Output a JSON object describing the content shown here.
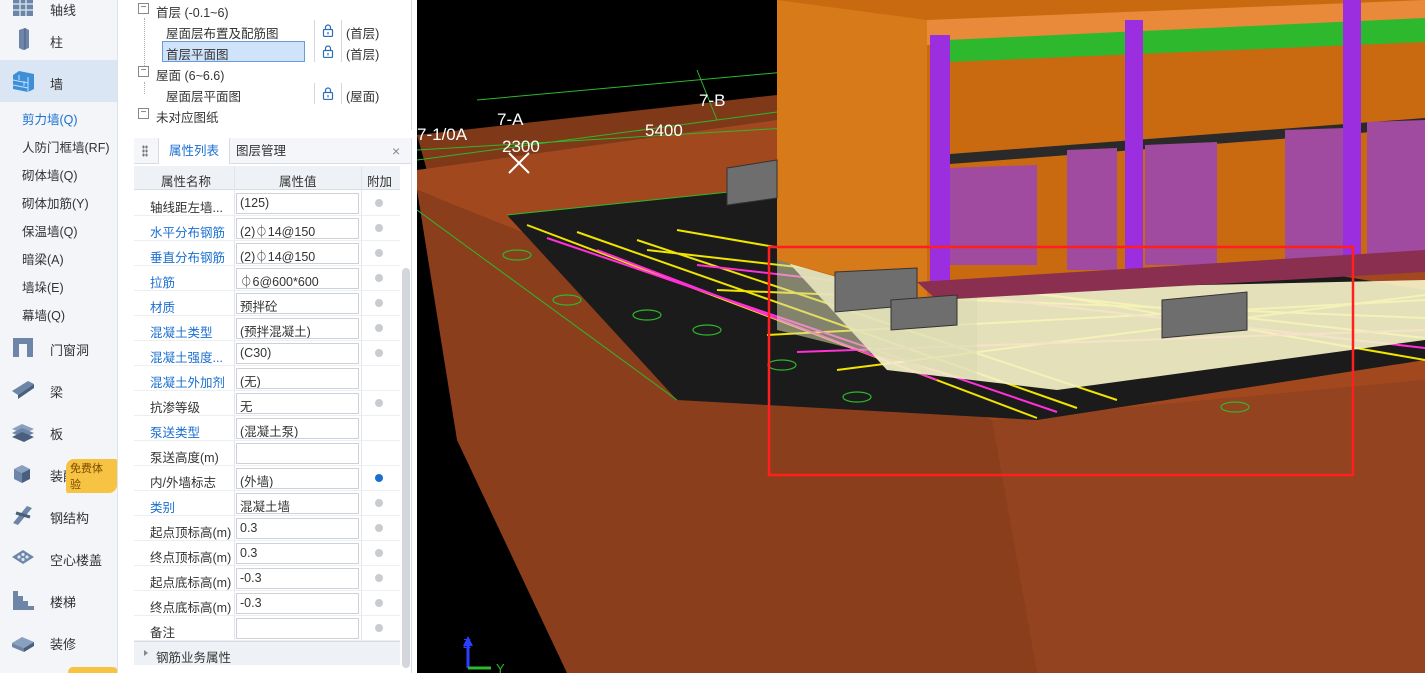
{
  "sidebar": {
    "categories": [
      {
        "label": "轴线",
        "icon": "grid-icon"
      },
      {
        "label": "柱",
        "icon": "column-icon"
      },
      {
        "label": "墙",
        "icon": "wall-icon"
      },
      {
        "label": "门窗洞",
        "icon": "door-window-icon"
      },
      {
        "label": "梁",
        "icon": "beam-icon"
      },
      {
        "label": "板",
        "icon": "slab-icon"
      },
      {
        "label": "装配式",
        "icon": "prefab-icon"
      },
      {
        "label": "钢结构",
        "icon": "steel-icon"
      },
      {
        "label": "空心楼盖",
        "icon": "hollow-slab-icon"
      },
      {
        "label": "楼梯",
        "icon": "stairs-icon"
      },
      {
        "label": "装修",
        "icon": "decoration-icon"
      }
    ],
    "wall_subitems": [
      "剪力墙(Q)",
      "人防门框墙(RF)",
      "砌体墙(Q)",
      "砌体加筋(Y)",
      "保温墙(Q)",
      "暗梁(A)",
      "墙垛(E)",
      "幕墙(Q)"
    ],
    "badge": "免费体验"
  },
  "tree": {
    "rows": [
      {
        "name": "首层 (-0.1~6)",
        "toggle": "−",
        "type": "group"
      },
      {
        "name": "屋面层布置及配筋图",
        "floor": "(首层)",
        "type": "item"
      },
      {
        "name": "首层平面图",
        "floor": "(首层)",
        "type": "item",
        "selected": true
      },
      {
        "name": "屋面 (6~6.6)",
        "toggle": "−",
        "type": "group"
      },
      {
        "name": "屋面层平面图",
        "floor": "(屋面)",
        "type": "item"
      },
      {
        "name": "未对应图纸",
        "toggle": "−",
        "type": "group"
      }
    ]
  },
  "props": {
    "tabs": [
      "属性列表",
      "图层管理"
    ],
    "close": "×",
    "headers": [
      "属性名称",
      "属性值",
      "附加"
    ],
    "rows": [
      {
        "name": "轴线距左墙...",
        "value": "(125)",
        "blue": false,
        "check": true
      },
      {
        "name": "水平分布钢筋",
        "value": "(2)⏀14@150",
        "blue": true,
        "check": true
      },
      {
        "name": "垂直分布钢筋",
        "value": "(2)⏀14@150",
        "blue": true,
        "check": true
      },
      {
        "name": "拉筋",
        "value": "⏀6@600*600",
        "blue": true,
        "check": true
      },
      {
        "name": "材质",
        "value": "预拌砼",
        "blue": true,
        "check": true
      },
      {
        "name": "混凝土类型",
        "value": "(预拌混凝土)",
        "blue": true,
        "check": true
      },
      {
        "name": "混凝土强度...",
        "value": "(C30)",
        "blue": true,
        "check": true
      },
      {
        "name": "混凝土外加剂",
        "value": "(无)",
        "blue": true,
        "check": false
      },
      {
        "name": "抗渗等级",
        "value": "无",
        "blue": false,
        "check": true
      },
      {
        "name": "泵送类型",
        "value": "(混凝土泵)",
        "blue": true,
        "check": false
      },
      {
        "name": "泵送高度(m)",
        "value": "",
        "blue": false,
        "check": false
      },
      {
        "name": "内/外墙标志",
        "value": "(外墙)",
        "blue": false,
        "check": true,
        "on": true
      },
      {
        "name": "类别",
        "value": "混凝土墙",
        "blue": true,
        "check": true
      },
      {
        "name": "起点顶标高(m)",
        "value": "0.3",
        "blue": false,
        "check": true
      },
      {
        "name": "终点顶标高(m)",
        "value": "0.3",
        "blue": false,
        "check": true
      },
      {
        "name": "起点底标高(m)",
        "value": "-0.3",
        "blue": false,
        "check": true
      },
      {
        "name": "终点底标高(m)",
        "value": "-0.3",
        "blue": false,
        "check": true
      },
      {
        "name": "备注",
        "value": "",
        "blue": false,
        "check": true
      }
    ],
    "footer": "钢筋业务属性"
  },
  "viewport": {
    "labels": [
      "7-1/0A",
      "7-A",
      "7-B",
      "2300",
      "5400"
    ],
    "axis": {
      "z": "Z",
      "y": "Y"
    },
    "colors": {
      "ground": "#8b3e1c",
      "building": "#c96a10",
      "accent": "#2db82d",
      "column": "#9b2fe0",
      "selection": "#ff1f1f",
      "grid": "#f0e400"
    }
  }
}
